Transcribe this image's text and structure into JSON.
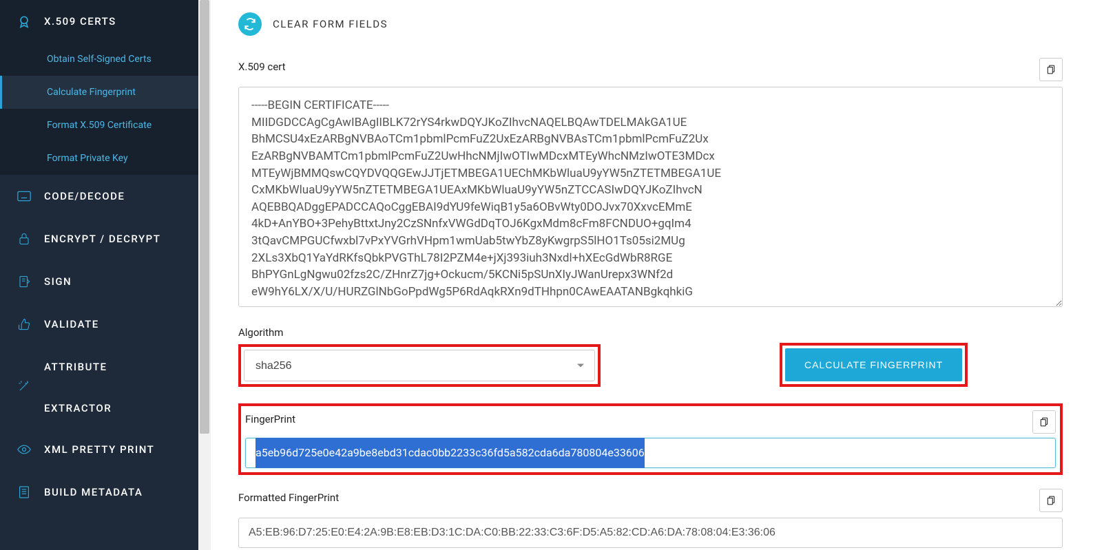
{
  "sidebar": {
    "certs": {
      "label": "X.509 CERTS",
      "items": [
        {
          "label": "Obtain Self-Signed Certs"
        },
        {
          "label": "Calculate Fingerprint"
        },
        {
          "label": "Format X.509 Certificate"
        },
        {
          "label": "Format Private Key"
        }
      ]
    },
    "sections": [
      {
        "label": "CODE/DECODE"
      },
      {
        "label": "ENCRYPT / DECRYPT"
      },
      {
        "label": "SIGN"
      },
      {
        "label": "VALIDATE"
      },
      {
        "label": "ATTRIBUTE"
      },
      {
        "label": "EXTRACTOR"
      },
      {
        "label": "XML PRETTY PRINT"
      },
      {
        "label": "BUILD METADATA"
      }
    ]
  },
  "main": {
    "clear_form": "CLEAR FORM FIELDS",
    "cert_label": "X.509 cert",
    "cert_value": "-----BEGIN CERTIFICATE-----\nMIIDGDCCAgCgAwIBAgIIBLK72rYS4rkwDQYJKoZIhvcNAQELBQAwTDELMAkGA1UE\nBhMCSU4xEzARBgNVBAoTCm1pbmlPcmFuZ2UxEzARBgNVBAsTCm1pbmlPcmFuZ2Ux\nEzARBgNVBAMTCm1pbmlPcmFuZ2UwHhcNMjIwOTIwMDcxMTEyWhcNMzIwOTE3MDcx\nMTEyWjBMMQswCQYDVQQGEwJJTjETMBEGA1UEChMKbWluaU9yYW5nZTETMBEGA1UE\nCxMKbWluaU9yYW5nZTETMBEGA1UEAxMKbWluaU9yYW5nZTCCASIwDQYJKoZIhvcN\nAQEBBQADggEPADCCAQoCggEBAI9dYU9feWiqB1y5a6OBvWty0DOJvx70XxvcEMmE\n4kD+AnYBO+3PehyBttxtJny2CzSNnfxVWGdDqTOJ6KgxMdm8cFm8FCNDUO+gqIm4\n3tQavCMPGUCfwxbl7vPxYVGrhVHpm1wmUab5twYbZ8yKwgrpS5lHO1Ts05si2MUg\n2XLs3XbQ1YaYdRKfsQbkPVGThL78I2PZM4e+jXj393iuh3Nxdl+hXEcGdWbR8RGE\nBhPYGnLgNgwu02fzs2C/ZHnrZ7jg+Ockucm/5KCNi5pSUnXIyJWanUrepx3WNf2d\neW9hY6LX/X/U/HURZGlNbGoPpdWg5P6RdAqkRXn9dTHhpn0CAwEAATANBgkqhkiG",
    "algo_label": "Algorithm",
    "algo_value": "sha256",
    "calc_button": "CALCULATE FINGERPRINT",
    "fingerprint_label": "FingerPrint",
    "fingerprint_value": "a5eb96d725e0e42a9be8ebd31cdac0bb2233c36fd5a582cda6da780804e33606",
    "formatted_label": "Formatted FingerPrint",
    "formatted_value": "A5:EB:96:D7:25:E0:E4:2A:9B:E8:EB:D3:1C:DA:C0:BB:22:33:C3:6F:D5:A5:82:CD:A6:DA:78:08:04:E3:36:06"
  }
}
